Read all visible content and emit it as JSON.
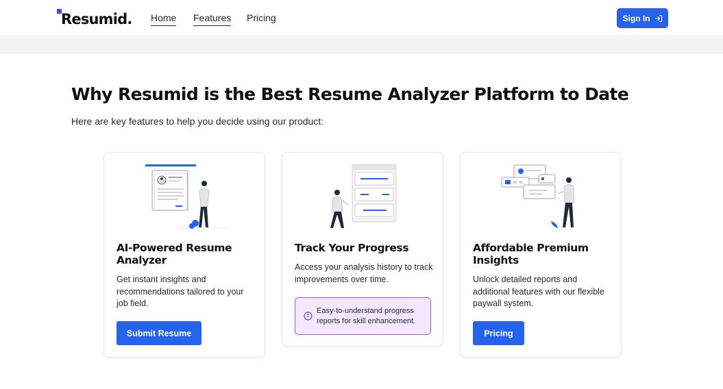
{
  "header": {
    "logo_text": "Resumid.",
    "nav": [
      {
        "label": "Home"
      },
      {
        "label": "Features"
      },
      {
        "label": "Pricing"
      }
    ],
    "signin_label": "Sign In"
  },
  "hero": {
    "title": "Why Resumid is the Best Resume Analyzer Platform to Date",
    "subtitle": "Here are key features to help you decide using our product:"
  },
  "cards": [
    {
      "title": "AI-Powered Resume Analyzer",
      "description": "Get instant insights and recommendations tailored to your job field.",
      "button_label": "Submit Resume",
      "illustration": "resume-person-illustration"
    },
    {
      "title": "Track Your Progress",
      "description": "Access your analysis history to track improvements over time.",
      "info_text": "Easy-to-understand progress reports for skill enhancement.",
      "illustration": "progress-person-illustration"
    },
    {
      "title": "Affordable Premium Insights",
      "description": "Unlock detailed reports and additional features with our flexible paywall system.",
      "button_label": "Pricing",
      "illustration": "insights-person-illustration"
    }
  ],
  "colors": {
    "accent": "#2563eb",
    "logo_square": "#4f46e5",
    "info_bg": "#f3e8ff",
    "info_border": "#a855f7"
  }
}
